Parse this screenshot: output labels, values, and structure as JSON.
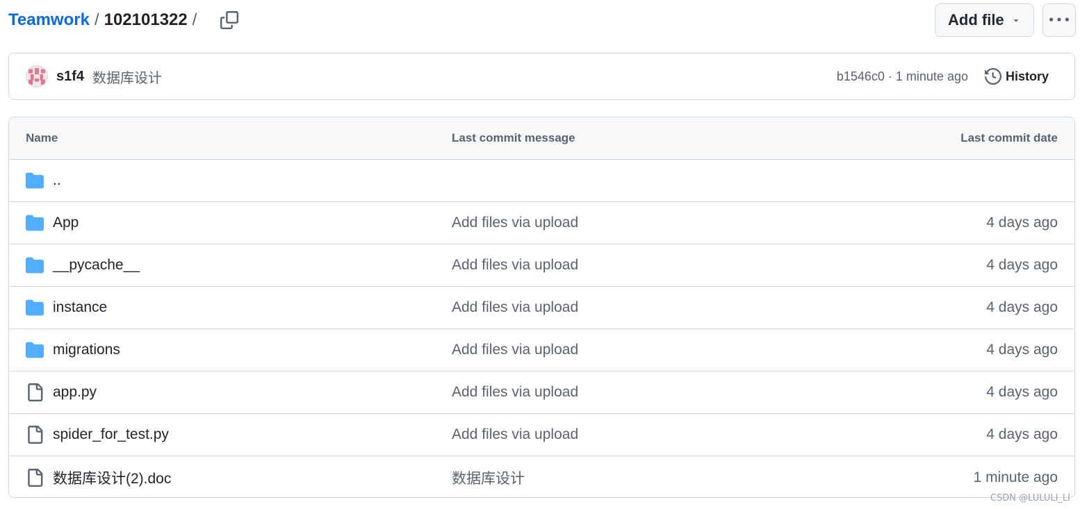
{
  "breadcrumb": {
    "owner": "Teamwork",
    "separator": "/",
    "folder": "102101322",
    "trailing_separator": "/"
  },
  "toolbar": {
    "add_file_label": "Add file",
    "copy_icon": "copy-icon",
    "more_icon": "kebab-horizontal-icon"
  },
  "latest_commit": {
    "author": "s1f4",
    "message": "数据库设计",
    "sha": "b1546c0",
    "separator": "·",
    "time": "1 minute ago",
    "history_label": "History"
  },
  "table": {
    "headers": {
      "name": "Name",
      "message": "Last commit message",
      "date": "Last commit date"
    },
    "parent": "..",
    "rows": [
      {
        "type": "folder",
        "name": "App",
        "message": "Add files via upload",
        "date": "4 days ago"
      },
      {
        "type": "folder",
        "name": "__pycache__",
        "message": "Add files via upload",
        "date": "4 days ago"
      },
      {
        "type": "folder",
        "name": "instance",
        "message": "Add files via upload",
        "date": "4 days ago"
      },
      {
        "type": "folder",
        "name": "migrations",
        "message": "Add files via upload",
        "date": "4 days ago"
      },
      {
        "type": "file",
        "name": "app.py",
        "message": "Add files via upload",
        "date": "4 days ago"
      },
      {
        "type": "file",
        "name": "spider_for_test.py",
        "message": "Add files via upload",
        "date": "4 days ago"
      },
      {
        "type": "file",
        "name": "数据库设计(2).doc",
        "message": "数据库设计",
        "date": "1 minute ago"
      }
    ]
  },
  "colors": {
    "link": "#0969da",
    "folder_icon": "#54aeff",
    "muted_text": "#59636e",
    "border": "#d1d9e0",
    "header_bg": "#f6f8fa"
  },
  "watermark": "CSDN @LULULI_LI"
}
